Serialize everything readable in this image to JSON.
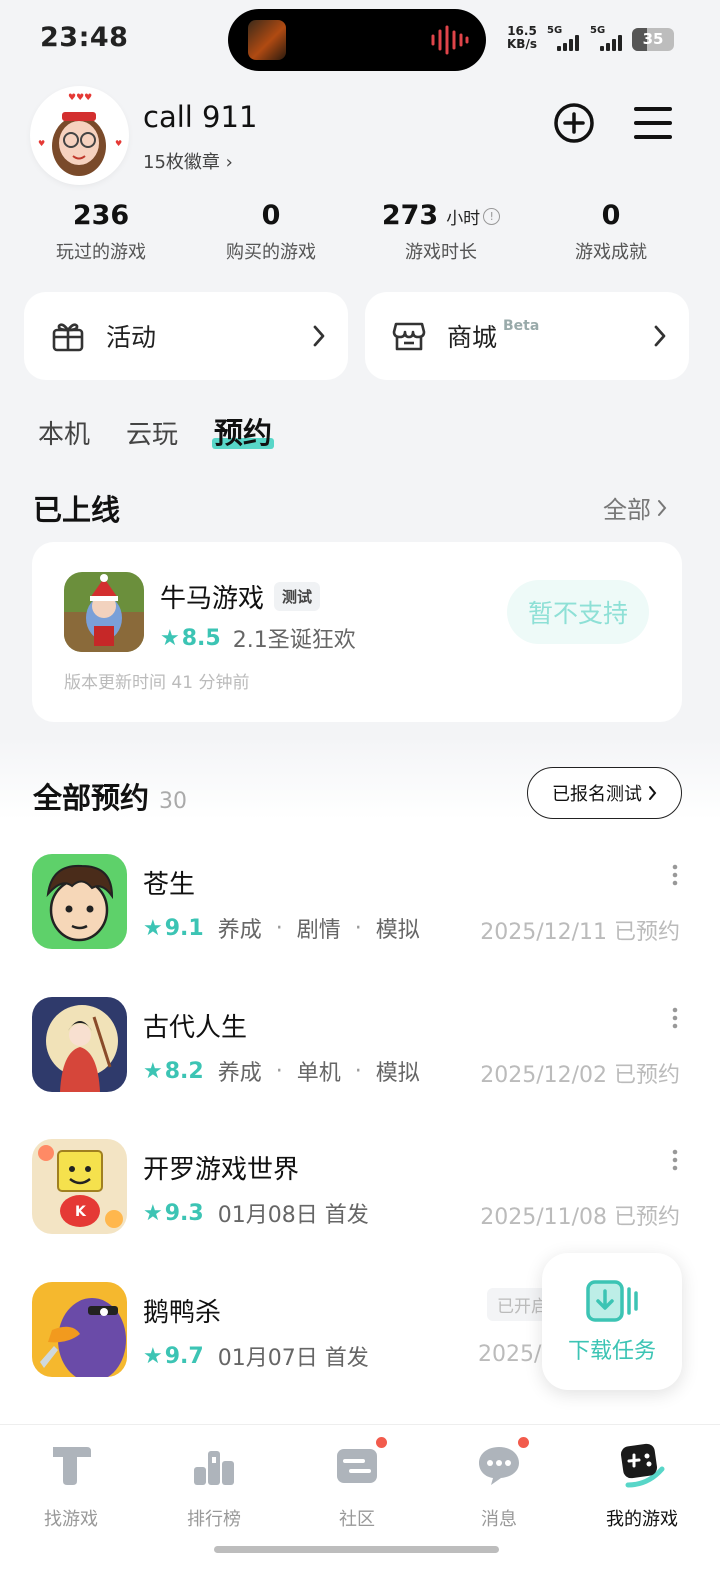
{
  "status_bar": {
    "time": "23:48",
    "net_speed_value": "16.5",
    "net_speed_unit": "KB/s",
    "sim1": "5G",
    "sim2": "5G",
    "battery": "35"
  },
  "profile": {
    "username": "call 911",
    "badges": "15枚徽章"
  },
  "stats": [
    {
      "value": "236",
      "label": "玩过的游戏"
    },
    {
      "value": "0",
      "label": "购买的游戏"
    },
    {
      "value": "273",
      "unit": "小时",
      "label": "游戏时长"
    },
    {
      "value": "0",
      "label": "游戏成就"
    }
  ],
  "cards": {
    "activity": "活动",
    "shop": "商城",
    "shop_badge": "Beta"
  },
  "tabs": [
    "本机",
    "云玩",
    "预约"
  ],
  "online_section": {
    "title": "已上线",
    "all_link": "全部",
    "game": {
      "name": "牛马游戏",
      "tag": "测试",
      "score": "8.5",
      "subtitle": "2.1圣诞狂欢",
      "update": "版本更新时间 41 分钟前",
      "action": "暂不支持"
    }
  },
  "reservations": {
    "title": "全部预约",
    "count": "30",
    "signup_button": "已报名测试",
    "items": [
      {
        "name": "苍生",
        "score": "9.1",
        "tags": [
          "养成",
          "剧情",
          "模拟"
        ],
        "date": "2025/12/11 已预约"
      },
      {
        "name": "古代人生",
        "score": "8.2",
        "tags": [
          "养成",
          "单机",
          "模拟"
        ],
        "date": "2025/12/02 已预约"
      },
      {
        "name": "开罗游戏世界",
        "score": "9.3",
        "release": "01月08日 首发",
        "date": "2025/11/08 已预约"
      },
      {
        "name": "鹅鸭杀",
        "score": "9.7",
        "release": "01月07日 首发",
        "date": "2025/",
        "tag": "已开启"
      }
    ]
  },
  "download_tasks": "下载任务",
  "bottom_nav": [
    {
      "label": "找游戏"
    },
    {
      "label": "排行榜"
    },
    {
      "label": "社区"
    },
    {
      "label": "消息"
    },
    {
      "label": "我的游戏"
    }
  ],
  "colors": {
    "accent": "#3cc4b4",
    "tab_highlight": "#58d6c8",
    "notify": "#f25b4c"
  }
}
